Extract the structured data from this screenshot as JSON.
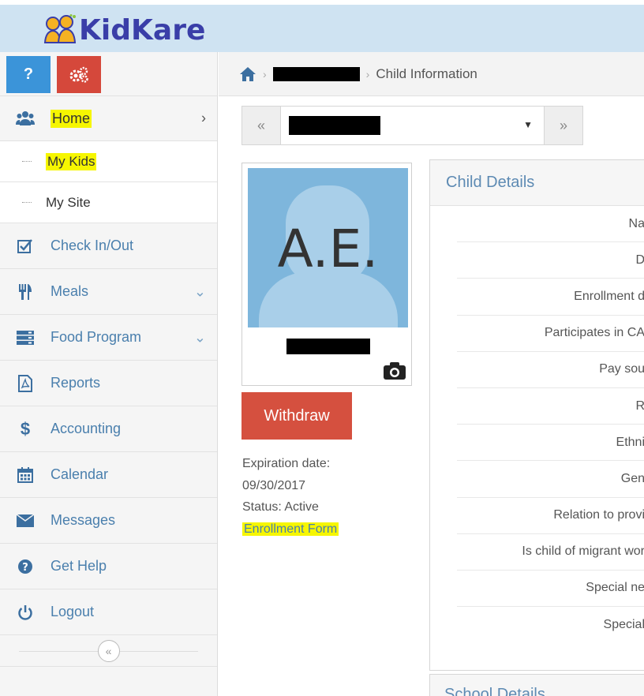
{
  "app": {
    "logo_text": "KidKare"
  },
  "sidebar": {
    "help_label": "?",
    "home": {
      "label": "Home",
      "highlighted": true,
      "icon": "users-icon"
    },
    "sub_items": [
      {
        "label": "My Kids",
        "highlighted": true
      },
      {
        "label": "My Site",
        "highlighted": false
      }
    ],
    "items": [
      {
        "label": "Check In/Out",
        "icon": "checkbox-icon",
        "has_chevron": false
      },
      {
        "label": "Meals",
        "icon": "utensils-icon",
        "has_chevron": true
      },
      {
        "label": "Food Program",
        "icon": "server-icon",
        "has_chevron": true
      },
      {
        "label": "Reports",
        "icon": "pdf-icon",
        "has_chevron": false
      },
      {
        "label": "Accounting",
        "icon": "dollar-icon",
        "has_chevron": false
      },
      {
        "label": "Calendar",
        "icon": "calendar-icon",
        "has_chevron": false
      },
      {
        "label": "Messages",
        "icon": "envelope-icon",
        "has_chevron": false
      },
      {
        "label": "Get Help",
        "icon": "question-circle-icon",
        "has_chevron": false
      },
      {
        "label": "Logout",
        "icon": "power-icon",
        "has_chevron": false
      }
    ]
  },
  "breadcrumb": {
    "current": "Child Information"
  },
  "child": {
    "initials": "A.E.",
    "withdraw_label": "Withdraw",
    "expiration_label": "Expiration date:",
    "expiration_date": "09/30/2017",
    "status": "Status: Active",
    "enrollment_link": "Enrollment Form"
  },
  "details": {
    "title": "Child Details",
    "rows": [
      "Na",
      "D",
      "Enrollment d",
      "Participates in CA",
      "Pay sou",
      "R",
      "Ethni",
      "Gen",
      "Relation to provi",
      "Is child of migrant wor",
      "Special ne",
      "Special"
    ]
  },
  "school": {
    "title": "School Details"
  },
  "colors": {
    "accent_blue": "#3b94d9",
    "danger_red": "#d5503f",
    "highlight_yellow": "#f6f600",
    "link_blue": "#4a7fad"
  }
}
